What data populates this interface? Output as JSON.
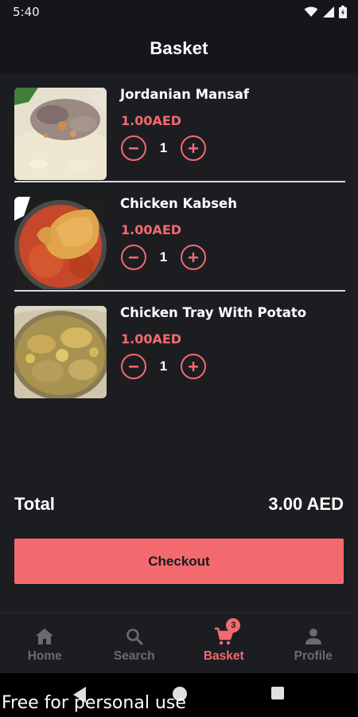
{
  "status_bar": {
    "time": "5:40",
    "icons": [
      "wifi-icon",
      "signal-icon",
      "battery-icon"
    ]
  },
  "header": {
    "title": "Basket"
  },
  "basket": {
    "items": [
      {
        "name": "Jordanian Mansaf",
        "price": "1.00AED",
        "quantity": "1",
        "image": "mansaf-photo"
      },
      {
        "name": "Chicken Kabseh",
        "price": "1.00AED",
        "quantity": "1",
        "image": "kabseh-photo"
      },
      {
        "name": "Chicken Tray With Potato",
        "price": "1.00AED",
        "quantity": "1",
        "image": "chicken-tray-photo"
      }
    ]
  },
  "summary": {
    "total_label": "Total",
    "total_value": "3.00 AED"
  },
  "checkout": {
    "label": "Checkout"
  },
  "bottom_nav": {
    "items": [
      {
        "label": "Home",
        "icon": "home-icon",
        "active": false
      },
      {
        "label": "Search",
        "icon": "search-icon",
        "active": false
      },
      {
        "label": "Basket",
        "icon": "cart-icon",
        "active": true,
        "badge": "3"
      },
      {
        "label": "Profile",
        "icon": "person-icon",
        "active": false
      }
    ]
  },
  "watermark": {
    "text": "Free for personal use"
  },
  "colors": {
    "accent": "#f26a6f",
    "background": "#1c1d21",
    "header_bg": "#15161a",
    "inactive": "#6a6b70"
  }
}
